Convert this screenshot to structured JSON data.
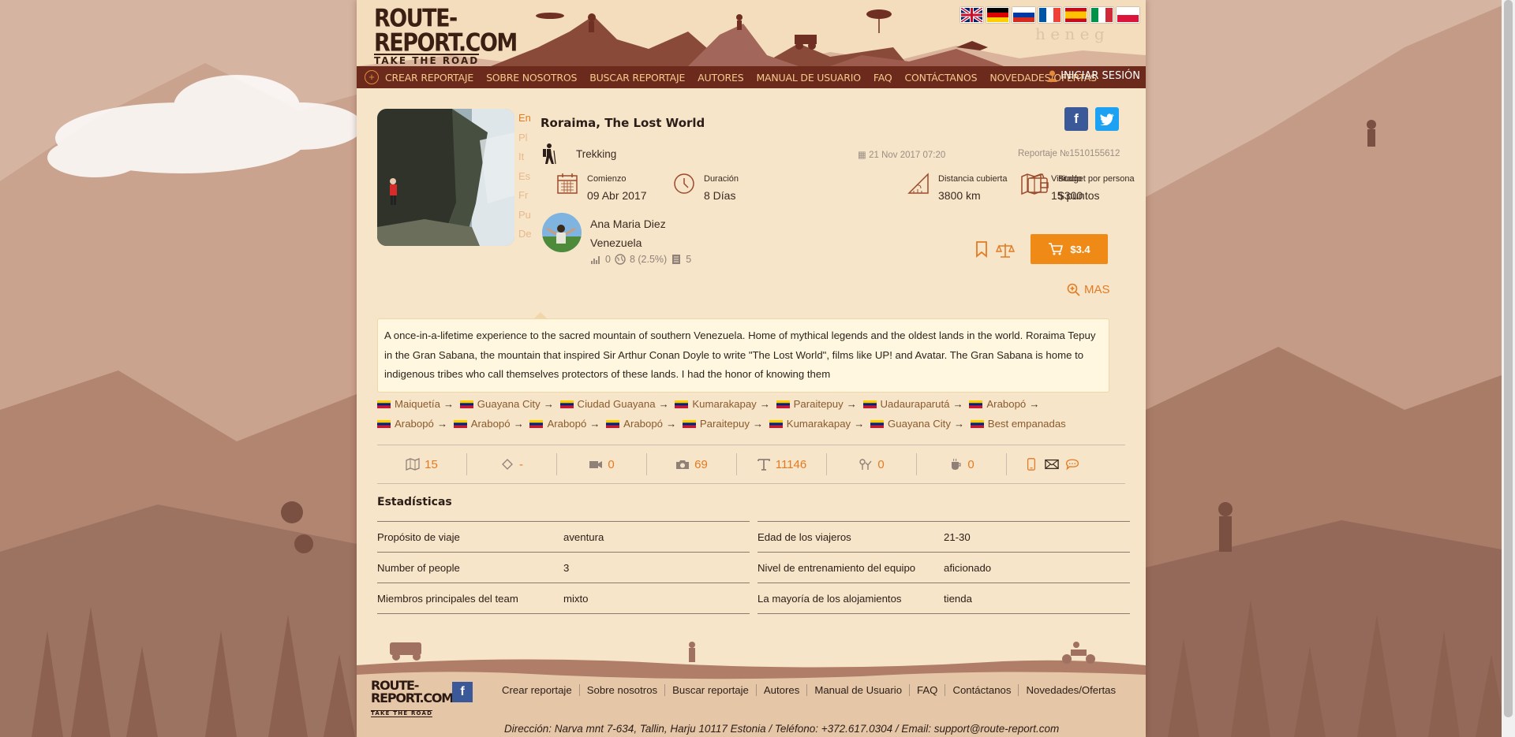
{
  "logo": {
    "line1": "ROUTE-REPORT.COM",
    "line2": "TAKE THE ROAD"
  },
  "flags": [
    "English",
    "German",
    "Russian",
    "French",
    "Spanish",
    "Italian",
    "Polish"
  ],
  "nav": {
    "items": [
      "CREAR REPORTAJE",
      "SOBRE NOSOTROS",
      "BUSCAR REPORTAJE",
      "AUTORES",
      "MANUAL DE USUARIO",
      "FAQ",
      "CONTÁCTANOS",
      "NOVEDADES/OFERTAS"
    ],
    "login": "INICIAR SESIÓN"
  },
  "report": {
    "title": "Roraima, The Lost World",
    "languages": [
      "En",
      "Pl",
      "It",
      "Es",
      "Fr",
      "Pu",
      "De"
    ],
    "active_language": "En",
    "type": "Trekking",
    "date": "21 Nov 2017 07:20",
    "report_number": "Reportaje №1510155612",
    "stats": [
      {
        "label": "Comienzo",
        "value": "09 Abr 2017",
        "icon": "calendar-icon"
      },
      {
        "label": "Duración",
        "value": "8 Días",
        "icon": "clock-icon"
      },
      {
        "label": "Distancia cubierta",
        "value": "3800 km",
        "icon": "distance-icon"
      },
      {
        "label": "Budget por persona",
        "value": "$300",
        "icon": "wallet-icon"
      },
      {
        "label": "Visitado",
        "value": "15 puntos",
        "icon": "map-icon"
      }
    ],
    "author": {
      "name": "Ana Maria Diez",
      "country": "Venezuela"
    },
    "author_stats": {
      "rating": "0",
      "reach": "8 (2.5%)",
      "reports": "5"
    },
    "price": "$3.4",
    "more_label": "MAS",
    "description": "A once-in-a-lifetime experience to the sacred mountain of southern Venezuela. Home of mythical legends and the oldest lands in the world. Roraima Tepuy in the Gran Sabana, the mountain that inspired Sir Arthur Conan Doyle to write \"The Lost World\", films like UP! and Avatar. The Gran Sabana is home to indigenous tribes who call themselves protectors of these lands. I had the honor of knowing them",
    "route": [
      "Maiquetía",
      "Guayana City",
      "Ciudad Guayana",
      "Kumarakapay",
      "Paraitepuy",
      "Uadauraparutá",
      "Arabopó",
      "Arabopó",
      "Arabopó",
      "Arabopó",
      "Arabopó",
      "Paraitepuy",
      "Kumarakapay",
      "Guayana City",
      "Best empanadas"
    ],
    "route_arrow": "→",
    "counters": [
      {
        "icon": "map-points-icon",
        "value": "15"
      },
      {
        "icon": "location-icon",
        "value": "-"
      },
      {
        "icon": "video-icon",
        "value": "0"
      },
      {
        "icon": "camera-icon",
        "value": "69"
      },
      {
        "icon": "text-icon",
        "value": "11146"
      },
      {
        "icon": "place-icon",
        "value": "0"
      },
      {
        "icon": "food-icon",
        "value": "0"
      }
    ]
  },
  "statistics": {
    "heading": "Estadísticas",
    "left": [
      {
        "key": "Propósito de viaje",
        "value": "aventura"
      },
      {
        "key": "Number of people",
        "value": "3"
      },
      {
        "key": "Miembros principales del team",
        "value": "mixto"
      }
    ],
    "right": [
      {
        "key": "Edad de los viajeros",
        "value": "21-30"
      },
      {
        "key": "Nivel de entrenamiento del equipo",
        "value": "aficionado"
      },
      {
        "key": "La mayoría de los alojamientos",
        "value": "tienda"
      }
    ]
  },
  "footer": {
    "links": [
      "Crear reportaje",
      "Sobre nosotros",
      "Buscar reportaje",
      "Autores",
      "Manual de Usuario",
      "FAQ",
      "Contáctanos",
      "Novedades/Ofertas"
    ],
    "address": "Dirección: Narva mnt 7-634, Tallin, Harju 10117 Estonia / Teléfono: +372.617.0304 / Email: support@route-report.com"
  },
  "colors": {
    "accent": "#f08a17",
    "nav_bg": "#6b2a1c",
    "link": "#8a5a2d",
    "page_bg": "#f6e5c8"
  }
}
